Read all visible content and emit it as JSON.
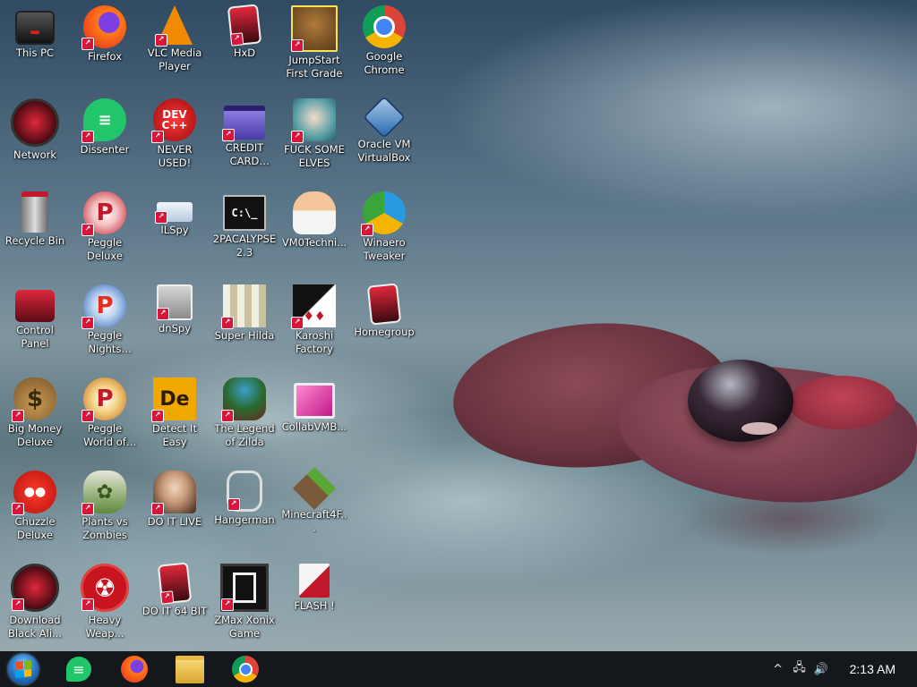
{
  "desktop": {
    "icons": [
      {
        "label": "This PC",
        "icon": "monitor-icon"
      },
      {
        "label": "Firefox",
        "icon": "firefox-icon"
      },
      {
        "label": "VLC Media Player",
        "icon": "vlc-cone-icon"
      },
      {
        "label": "HxD",
        "icon": "hxd-icon"
      },
      {
        "label": "JumpStart First Grade",
        "icon": "jumpstart-icon"
      },
      {
        "label": "Google Chrome",
        "icon": "chrome-icon"
      },
      {
        "label": "Network",
        "icon": "network-icon"
      },
      {
        "label": "Dissenter",
        "icon": "dissenter-icon"
      },
      {
        "label": "NEVER USED!",
        "icon": "devcpp-icon"
      },
      {
        "label": "CREDIT CARD CHECKER",
        "icon": "credit-card-icon"
      },
      {
        "label": "FUCK SOME ELVES",
        "icon": "elf-icon"
      },
      {
        "label": "Oracle VM VirtualBox",
        "icon": "virtualbox-icon"
      },
      {
        "label": "Recycle Bin",
        "icon": "recycle-bin-icon"
      },
      {
        "label": "Peggle Deluxe",
        "icon": "peggle-icon"
      },
      {
        "label": "ILSpy",
        "icon": "ilspy-icon"
      },
      {
        "label": "2PACALYPSE 2.3",
        "icon": "terminal-icon"
      },
      {
        "label": "VM0Techni...",
        "icon": "doctor-icon"
      },
      {
        "label": "Winaero Tweaker",
        "icon": "winaero-icon"
      },
      {
        "label": "Control Panel",
        "icon": "control-panel-icon"
      },
      {
        "label": "Peggle Nights Deluxe",
        "icon": "peggle-nights-icon"
      },
      {
        "label": "dnSpy",
        "icon": "dnspy-icon"
      },
      {
        "label": "Super Hilda",
        "icon": "super-hilda-icon"
      },
      {
        "label": "Karoshi Factory",
        "icon": "karoshi-icon"
      },
      {
        "label": "Homegroup",
        "icon": "homegroup-icon"
      },
      {
        "label": "Big Money Deluxe",
        "icon": "money-bag-icon"
      },
      {
        "label": "Peggle World of Warcraft ...",
        "icon": "peggle-wow-icon"
      },
      {
        "label": "Detect It Easy",
        "icon": "die-icon"
      },
      {
        "label": "The Legend of Zilda",
        "icon": "zilda-icon"
      },
      {
        "label": "CollabVMB...",
        "icon": "collabvm-icon"
      },
      {
        "label": "Chuzzle Deluxe",
        "icon": "chuzzle-icon"
      },
      {
        "label": "Plants vs Zombies",
        "icon": "pvz-icon"
      },
      {
        "label": "DO IT LIVE",
        "icon": "portrait-icon"
      },
      {
        "label": "Hangerman",
        "icon": "hangerman-icon"
      },
      {
        "label": "Minecraft4F...",
        "icon": "minecraft-icon"
      },
      {
        "label": "Download Black Ali...",
        "icon": "download-icon"
      },
      {
        "label": "Heavy Weap...",
        "icon": "radiation-icon"
      },
      {
        "label": "DO IT 64 BIT",
        "icon": "do-it-64-icon"
      },
      {
        "label": "ZMax Xonix Game",
        "icon": "xonix-icon"
      },
      {
        "label": "FLASH !",
        "icon": "flash-icon"
      }
    ]
  },
  "taskbar": {
    "start": "start-button",
    "pinned": [
      "dissenter-icon",
      "firefox-icon",
      "file-explorer-icon",
      "chrome-icon"
    ],
    "tray": {
      "chevron": "^",
      "clock": "2:13 AM"
    }
  }
}
